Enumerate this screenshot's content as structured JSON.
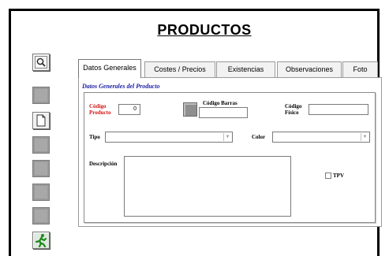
{
  "window": {
    "title": "PRODUCTOS"
  },
  "toolbar": {
    "buttons": [
      {
        "name": "search",
        "icon": "magnifier-icon",
        "state": "enabled"
      },
      {
        "name": "action-2",
        "icon": "blank-icon",
        "state": "disabled"
      },
      {
        "name": "new",
        "icon": "new-document-icon",
        "state": "enabled"
      },
      {
        "name": "action-4",
        "icon": "blank-icon",
        "state": "disabled"
      },
      {
        "name": "action-5",
        "icon": "blank-icon",
        "state": "disabled"
      },
      {
        "name": "action-6",
        "icon": "blank-icon",
        "state": "disabled"
      },
      {
        "name": "action-7",
        "icon": "blank-icon",
        "state": "disabled"
      },
      {
        "name": "exit",
        "icon": "running-man-icon",
        "state": "enabled"
      }
    ]
  },
  "tabs": [
    {
      "label": "Datos Generales",
      "active": true
    },
    {
      "label": "Costes / Precios",
      "active": false
    },
    {
      "label": "Existencias",
      "active": false
    },
    {
      "label": "Observaciones",
      "active": false
    },
    {
      "label": "Foto",
      "active": false
    }
  ],
  "panel": {
    "section_title": "Datos Generales del Producto",
    "codigo_producto": {
      "label_line1": "Código",
      "label_line2": "Producto",
      "value": "0"
    },
    "codigo_barras": {
      "label": "Código Barras",
      "value": ""
    },
    "codigo_fisico": {
      "label_line1": "Código",
      "label_line2": "Físico",
      "value": ""
    },
    "tipo": {
      "label": "Tipo",
      "value": ""
    },
    "color": {
      "label": "Color",
      "value": ""
    },
    "descripcion": {
      "label": "Descripción",
      "value": ""
    },
    "tpv": {
      "label": "TPV",
      "checked": false
    }
  },
  "colors": {
    "required_label": "#d01414",
    "section_title": "#1a1aa6"
  }
}
